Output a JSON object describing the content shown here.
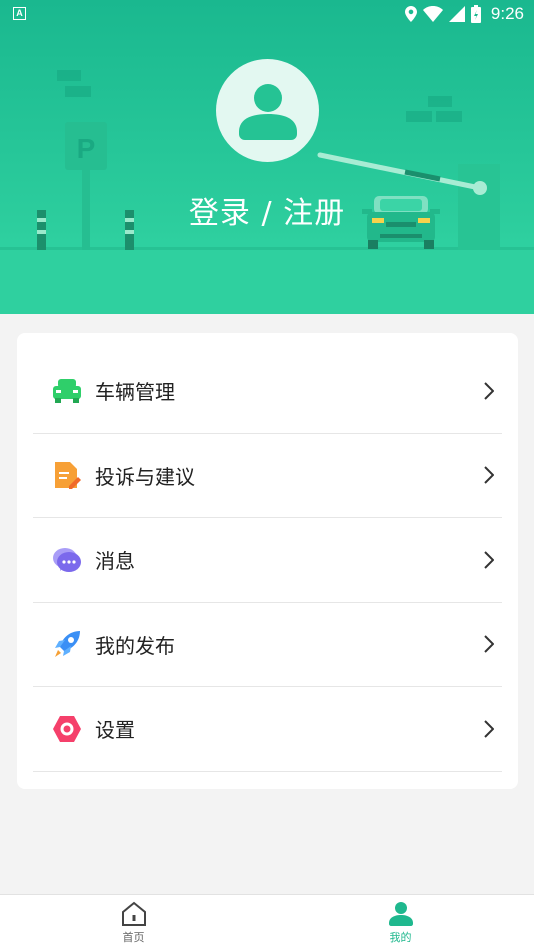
{
  "status_bar": {
    "notification_icon": "a-letter-icon",
    "time": "9:26",
    "icons": [
      "location-icon",
      "wifi-icon",
      "signal-icon",
      "battery-icon"
    ]
  },
  "header": {
    "login_label": "登录 / 注册",
    "parking_sign": "P",
    "avatar_icon": "user-avatar-icon"
  },
  "menu": {
    "items": [
      {
        "label": "车辆管理",
        "icon": "car-icon",
        "color": "#2fcf6a"
      },
      {
        "label": "投诉与建议",
        "icon": "document-edit-icon",
        "color": "#f7a036"
      },
      {
        "label": "消息",
        "icon": "chat-bubble-icon",
        "color": "#8f7cf0"
      },
      {
        "label": "我的发布",
        "icon": "rocket-icon",
        "color": "#3a8ff5"
      },
      {
        "label": "设置",
        "icon": "hexagon-settings-icon",
        "color": "#f5406b"
      }
    ]
  },
  "tabbar": {
    "tabs": [
      {
        "label": "首页",
        "icon": "home-icon",
        "active": false
      },
      {
        "label": "我的",
        "icon": "profile-icon",
        "active": true
      }
    ],
    "active_color": "#1fb88e"
  }
}
